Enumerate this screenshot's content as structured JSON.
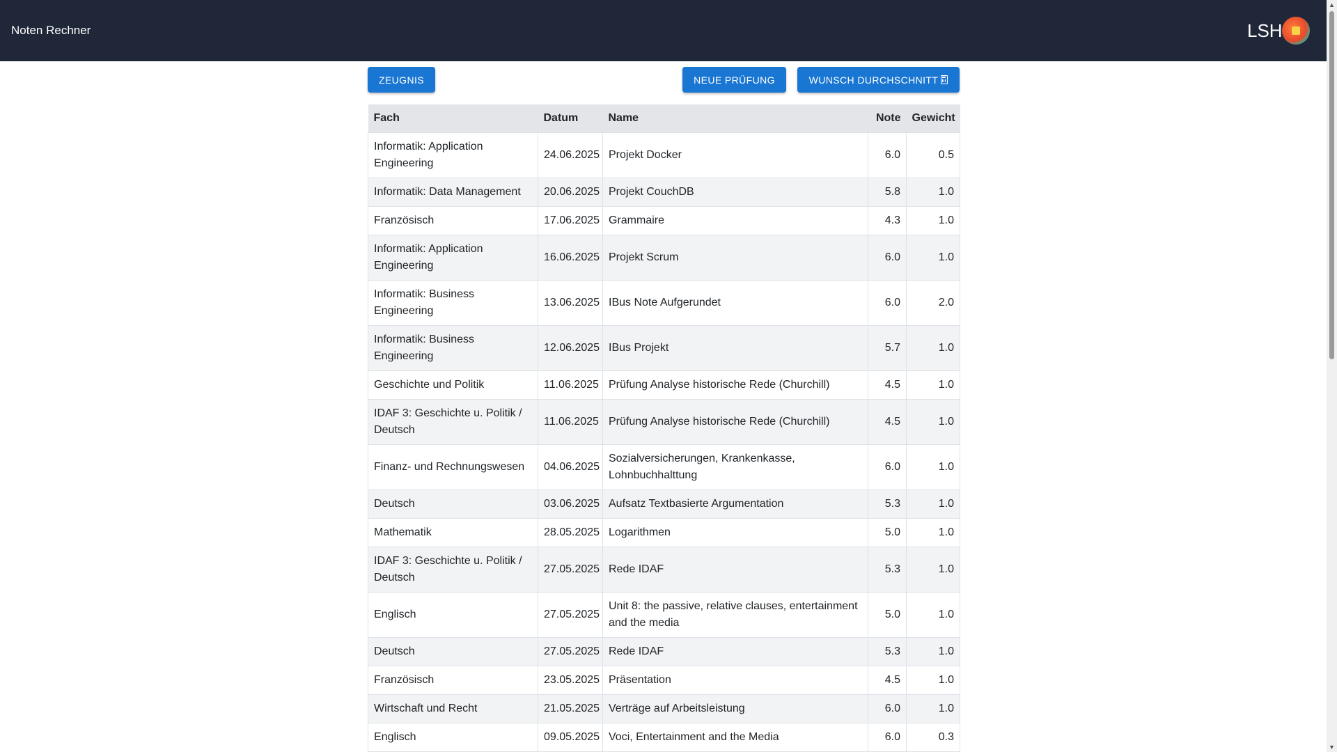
{
  "header": {
    "app_title": "Noten Rechner",
    "user_initials": "LSH",
    "background_color": "#1f2738"
  },
  "toolbar": {
    "zeugnis_label": "ZEUGNIS",
    "neue_pruefung_label": "NEUE PRÜFUNG",
    "wunsch_durchschnitt_label": "WUNSCH DURCHSCHNITT",
    "wunsch_icon": "calculator-icon",
    "button_color": "#1976d2"
  },
  "table": {
    "columns": [
      "Fach",
      "Datum",
      "Name",
      "Note",
      "Gewicht"
    ],
    "rows": [
      {
        "fach": "Informatik: Application Engineering",
        "datum": "24.06.2025",
        "name": "Projekt Docker",
        "note": "6.0",
        "gewicht": "0.5"
      },
      {
        "fach": "Informatik: Data Management",
        "datum": "20.06.2025",
        "name": "Projekt CouchDB",
        "note": "5.8",
        "gewicht": "1.0"
      },
      {
        "fach": "Französisch",
        "datum": "17.06.2025",
        "name": "Grammaire",
        "note": "4.3",
        "gewicht": "1.0"
      },
      {
        "fach": "Informatik: Application Engineering",
        "datum": "16.06.2025",
        "name": "Projekt Scrum",
        "note": "6.0",
        "gewicht": "1.0"
      },
      {
        "fach": "Informatik: Business Engineering",
        "datum": "13.06.2025",
        "name": "IBus Note Aufgerundet",
        "note": "6.0",
        "gewicht": "2.0"
      },
      {
        "fach": "Informatik: Business Engineering",
        "datum": "12.06.2025",
        "name": "IBus Projekt",
        "note": "5.7",
        "gewicht": "1.0"
      },
      {
        "fach": "Geschichte und Politik",
        "datum": "11.06.2025",
        "name": "Prüfung Analyse historische Rede (Churchill)",
        "note": "4.5",
        "gewicht": "1.0"
      },
      {
        "fach": "IDAF 3: Geschichte u. Politik / Deutsch",
        "datum": "11.06.2025",
        "name": "Prüfung Analyse historische Rede (Churchill)",
        "note": "4.5",
        "gewicht": "1.0"
      },
      {
        "fach": "Finanz- und Rechnungswesen",
        "datum": "04.06.2025",
        "name": "Sozialversicherungen, Krankenkasse, Lohnbuchhalttung",
        "note": "6.0",
        "gewicht": "1.0"
      },
      {
        "fach": "Deutsch",
        "datum": "03.06.2025",
        "name": "Aufsatz Textbasierte Argumentation",
        "note": "5.3",
        "gewicht": "1.0"
      },
      {
        "fach": "Mathematik",
        "datum": "28.05.2025",
        "name": "Logarithmen",
        "note": "5.0",
        "gewicht": "1.0"
      },
      {
        "fach": "IDAF 3: Geschichte u. Politik / Deutsch",
        "datum": "27.05.2025",
        "name": "Rede IDAF",
        "note": "5.3",
        "gewicht": "1.0"
      },
      {
        "fach": "Englisch",
        "datum": "27.05.2025",
        "name": "Unit 8: the passive, relative clauses, entertainment and the media",
        "note": "5.0",
        "gewicht": "1.0"
      },
      {
        "fach": "Deutsch",
        "datum": "27.05.2025",
        "name": "Rede IDAF",
        "note": "5.3",
        "gewicht": "1.0"
      },
      {
        "fach": "Französisch",
        "datum": "23.05.2025",
        "name": "Präsentation",
        "note": "4.5",
        "gewicht": "1.0"
      },
      {
        "fach": "Wirtschaft und Recht",
        "datum": "21.05.2025",
        "name": "Verträge auf Arbeitsleistung",
        "note": "6.0",
        "gewicht": "1.0"
      },
      {
        "fach": "Englisch",
        "datum": "09.05.2025",
        "name": "Voci, Entertainment and the Media",
        "note": "6.0",
        "gewicht": "0.3"
      }
    ]
  }
}
